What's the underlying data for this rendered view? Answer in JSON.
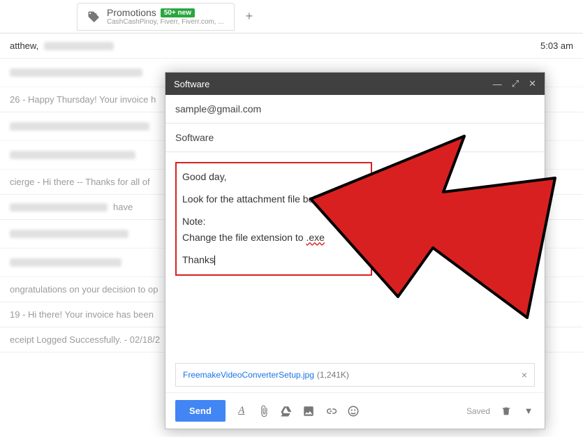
{
  "tabs": {
    "promotions": {
      "title": "Promotions",
      "badge": "50+ new",
      "subtitle": "CashCashPinoy, Fiverr, Fiverr.com, ..."
    },
    "add": "+"
  },
  "emails": {
    "row1": {
      "sender": "atthew,",
      "preview": "",
      "time": "5:03 am"
    },
    "row2": {
      "text": "26 - Happy Thursday! Your invoice h"
    },
    "row3": {
      "text": "cierge - Hi there -- Thanks for all of"
    },
    "row4": {
      "text": "have"
    },
    "row5": {
      "text": "ongratulations on your decision to op"
    },
    "row6": {
      "text": "19 - Hi there! Your invoice has been"
    },
    "row7": {
      "text": "eceipt Logged Successfully. - 02/18/2"
    }
  },
  "compose": {
    "title": "Software",
    "to": "sample@gmail.com",
    "subject": "Software",
    "body": {
      "greeting": "Good day,",
      "line1": "Look for the attachment file below.",
      "note_label": "Note:",
      "note_text": "Change the file extension to ",
      "exe": ".exe",
      "closing": "Thanks"
    },
    "attachment": {
      "name": "FreemakeVideoConverterSetup.jpg",
      "size": "(1,241K)"
    },
    "toolbar": {
      "send": "Send",
      "saved": "Saved"
    }
  }
}
